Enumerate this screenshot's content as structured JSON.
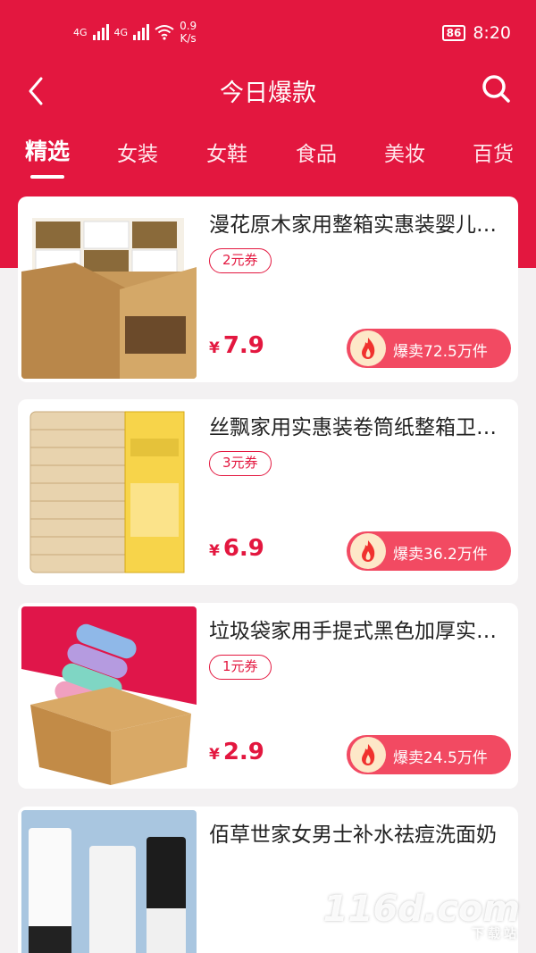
{
  "status_bar": {
    "network1": "4G",
    "network2": "4G",
    "speed_value": "0.9",
    "speed_unit": "K/s",
    "battery": "86",
    "time": "8:20"
  },
  "nav": {
    "title": "今日爆款",
    "back_icon": "chevron-left-icon",
    "search_icon": "search-icon"
  },
  "tabs": [
    {
      "label": "精选",
      "active": true
    },
    {
      "label": "女装",
      "active": false
    },
    {
      "label": "女鞋",
      "active": false
    },
    {
      "label": "食品",
      "active": false
    },
    {
      "label": "美妆",
      "active": false
    },
    {
      "label": "百货",
      "active": false
    }
  ],
  "products": [
    {
      "title": "漫花原木家用整箱实惠装婴儿纸巾",
      "coupon": "2元券",
      "currency": "¥",
      "price": "7.9",
      "sales": "爆卖72.5万件"
    },
    {
      "title": "丝飘家用实惠装卷筒纸整箱卫生纸",
      "coupon": "3元券",
      "currency": "¥",
      "price": "6.9",
      "sales": "爆卖36.2万件"
    },
    {
      "title": "垃圾袋家用手提式黑色加厚实惠装",
      "coupon": "1元券",
      "currency": "¥",
      "price": "2.9",
      "sales": "爆卖24.5万件"
    },
    {
      "title": "佰草世家女男士补水祛痘洗面奶",
      "coupon": "",
      "currency": "¥",
      "price": "",
      "sales": ""
    }
  ],
  "watermark": {
    "brand": "116d.com",
    "sub": "下载站"
  },
  "colors": {
    "accent": "#e3173f",
    "sales_pill": "#f24a62",
    "background": "#f3f1f2"
  }
}
